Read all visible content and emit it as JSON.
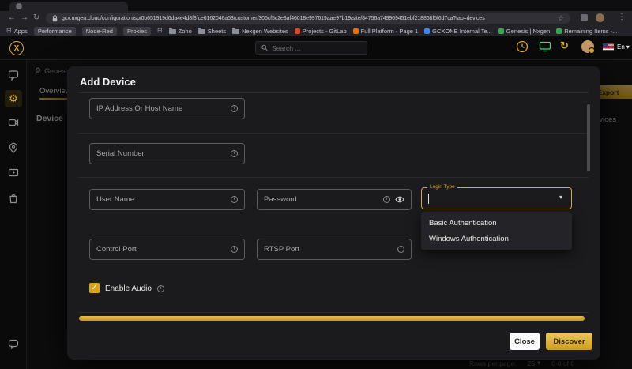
{
  "icons": {
    "back": "←",
    "forward": "→",
    "reload": "↻",
    "star": "☆",
    "kebab": "⋮",
    "grid": "⊞",
    "gear": "⚙",
    "logo": "X",
    "refresh": "↻",
    "caret_down": "▾",
    "info": "i",
    "check": "✓"
  },
  "browser": {
    "url": "gcx.nxgen.cloud/configuration/sp/0b651919d6da4e4d8f3fce6162046a53/customer/305cf5c2e3af46018e997619aae97b19/site/84756a749969451ebf218868f5f6d7ca?tab=devices",
    "bookmarks": [
      {
        "label": "Apps"
      },
      {
        "label": "Performance"
      },
      {
        "label": "Node-Red"
      },
      {
        "label": "Proxies"
      },
      {
        "label": "Zoho"
      },
      {
        "label": "Sheets"
      },
      {
        "label": "Nexgen Websites"
      },
      {
        "label": "Projects - GitLab"
      },
      {
        "label": "Full Platform - Page 1"
      },
      {
        "label": "GCXONE Internal Te..."
      },
      {
        "label": "Genesis | Nxgen"
      },
      {
        "label": "Remaining Items -..."
      }
    ]
  },
  "app_header": {
    "search_placeholder": "Search ...",
    "language": "En"
  },
  "page": {
    "breadcrumb": "Genesis",
    "overview_tab": "Overview",
    "device_label": "Device",
    "export_button": "Export",
    "devices_partial": "Devices",
    "pagination": {
      "rows_per_page_label": "Rows per page:",
      "rows_per_page_value": "25",
      "range": "0-0 of 0"
    }
  },
  "modal": {
    "title": "Add Device",
    "fields": {
      "ip": "IP Address Or Host Name",
      "serial": "Serial Number",
      "username": "User Name",
      "password": "Password",
      "login_type": "Login Type",
      "control_port": "Control Port",
      "rtsp_port": "RTSP Port"
    },
    "login_options": [
      "Basic Authentication",
      "Windows Authentication"
    ],
    "enable_audio_label": "Enable Audio",
    "close_button": "Close",
    "discover_button": "Discover"
  },
  "colors": {
    "accent": "#d9a92c",
    "green": "#3ddc84"
  }
}
